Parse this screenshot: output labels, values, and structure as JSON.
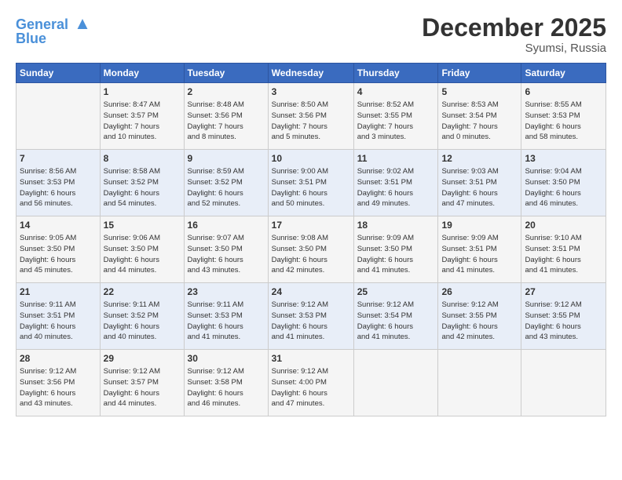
{
  "header": {
    "logo_line1": "General",
    "logo_line2": "Blue",
    "month": "December 2025",
    "location": "Syumsi, Russia"
  },
  "weekdays": [
    "Sunday",
    "Monday",
    "Tuesday",
    "Wednesday",
    "Thursday",
    "Friday",
    "Saturday"
  ],
  "weeks": [
    [
      {
        "day": "",
        "info": ""
      },
      {
        "day": "1",
        "info": "Sunrise: 8:47 AM\nSunset: 3:57 PM\nDaylight: 7 hours\nand 10 minutes."
      },
      {
        "day": "2",
        "info": "Sunrise: 8:48 AM\nSunset: 3:56 PM\nDaylight: 7 hours\nand 8 minutes."
      },
      {
        "day": "3",
        "info": "Sunrise: 8:50 AM\nSunset: 3:56 PM\nDaylight: 7 hours\nand 5 minutes."
      },
      {
        "day": "4",
        "info": "Sunrise: 8:52 AM\nSunset: 3:55 PM\nDaylight: 7 hours\nand 3 minutes."
      },
      {
        "day": "5",
        "info": "Sunrise: 8:53 AM\nSunset: 3:54 PM\nDaylight: 7 hours\nand 0 minutes."
      },
      {
        "day": "6",
        "info": "Sunrise: 8:55 AM\nSunset: 3:53 PM\nDaylight: 6 hours\nand 58 minutes."
      }
    ],
    [
      {
        "day": "7",
        "info": "Sunrise: 8:56 AM\nSunset: 3:53 PM\nDaylight: 6 hours\nand 56 minutes."
      },
      {
        "day": "8",
        "info": "Sunrise: 8:58 AM\nSunset: 3:52 PM\nDaylight: 6 hours\nand 54 minutes."
      },
      {
        "day": "9",
        "info": "Sunrise: 8:59 AM\nSunset: 3:52 PM\nDaylight: 6 hours\nand 52 minutes."
      },
      {
        "day": "10",
        "info": "Sunrise: 9:00 AM\nSunset: 3:51 PM\nDaylight: 6 hours\nand 50 minutes."
      },
      {
        "day": "11",
        "info": "Sunrise: 9:02 AM\nSunset: 3:51 PM\nDaylight: 6 hours\nand 49 minutes."
      },
      {
        "day": "12",
        "info": "Sunrise: 9:03 AM\nSunset: 3:51 PM\nDaylight: 6 hours\nand 47 minutes."
      },
      {
        "day": "13",
        "info": "Sunrise: 9:04 AM\nSunset: 3:50 PM\nDaylight: 6 hours\nand 46 minutes."
      }
    ],
    [
      {
        "day": "14",
        "info": "Sunrise: 9:05 AM\nSunset: 3:50 PM\nDaylight: 6 hours\nand 45 minutes."
      },
      {
        "day": "15",
        "info": "Sunrise: 9:06 AM\nSunset: 3:50 PM\nDaylight: 6 hours\nand 44 minutes."
      },
      {
        "day": "16",
        "info": "Sunrise: 9:07 AM\nSunset: 3:50 PM\nDaylight: 6 hours\nand 43 minutes."
      },
      {
        "day": "17",
        "info": "Sunrise: 9:08 AM\nSunset: 3:50 PM\nDaylight: 6 hours\nand 42 minutes."
      },
      {
        "day": "18",
        "info": "Sunrise: 9:09 AM\nSunset: 3:50 PM\nDaylight: 6 hours\nand 41 minutes."
      },
      {
        "day": "19",
        "info": "Sunrise: 9:09 AM\nSunset: 3:51 PM\nDaylight: 6 hours\nand 41 minutes."
      },
      {
        "day": "20",
        "info": "Sunrise: 9:10 AM\nSunset: 3:51 PM\nDaylight: 6 hours\nand 41 minutes."
      }
    ],
    [
      {
        "day": "21",
        "info": "Sunrise: 9:11 AM\nSunset: 3:51 PM\nDaylight: 6 hours\nand 40 minutes."
      },
      {
        "day": "22",
        "info": "Sunrise: 9:11 AM\nSunset: 3:52 PM\nDaylight: 6 hours\nand 40 minutes."
      },
      {
        "day": "23",
        "info": "Sunrise: 9:11 AM\nSunset: 3:53 PM\nDaylight: 6 hours\nand 41 minutes."
      },
      {
        "day": "24",
        "info": "Sunrise: 9:12 AM\nSunset: 3:53 PM\nDaylight: 6 hours\nand 41 minutes."
      },
      {
        "day": "25",
        "info": "Sunrise: 9:12 AM\nSunset: 3:54 PM\nDaylight: 6 hours\nand 41 minutes."
      },
      {
        "day": "26",
        "info": "Sunrise: 9:12 AM\nSunset: 3:55 PM\nDaylight: 6 hours\nand 42 minutes."
      },
      {
        "day": "27",
        "info": "Sunrise: 9:12 AM\nSunset: 3:55 PM\nDaylight: 6 hours\nand 43 minutes."
      }
    ],
    [
      {
        "day": "28",
        "info": "Sunrise: 9:12 AM\nSunset: 3:56 PM\nDaylight: 6 hours\nand 43 minutes."
      },
      {
        "day": "29",
        "info": "Sunrise: 9:12 AM\nSunset: 3:57 PM\nDaylight: 6 hours\nand 44 minutes."
      },
      {
        "day": "30",
        "info": "Sunrise: 9:12 AM\nSunset: 3:58 PM\nDaylight: 6 hours\nand 46 minutes."
      },
      {
        "day": "31",
        "info": "Sunrise: 9:12 AM\nSunset: 4:00 PM\nDaylight: 6 hours\nand 47 minutes."
      },
      {
        "day": "",
        "info": ""
      },
      {
        "day": "",
        "info": ""
      },
      {
        "day": "",
        "info": ""
      }
    ]
  ]
}
